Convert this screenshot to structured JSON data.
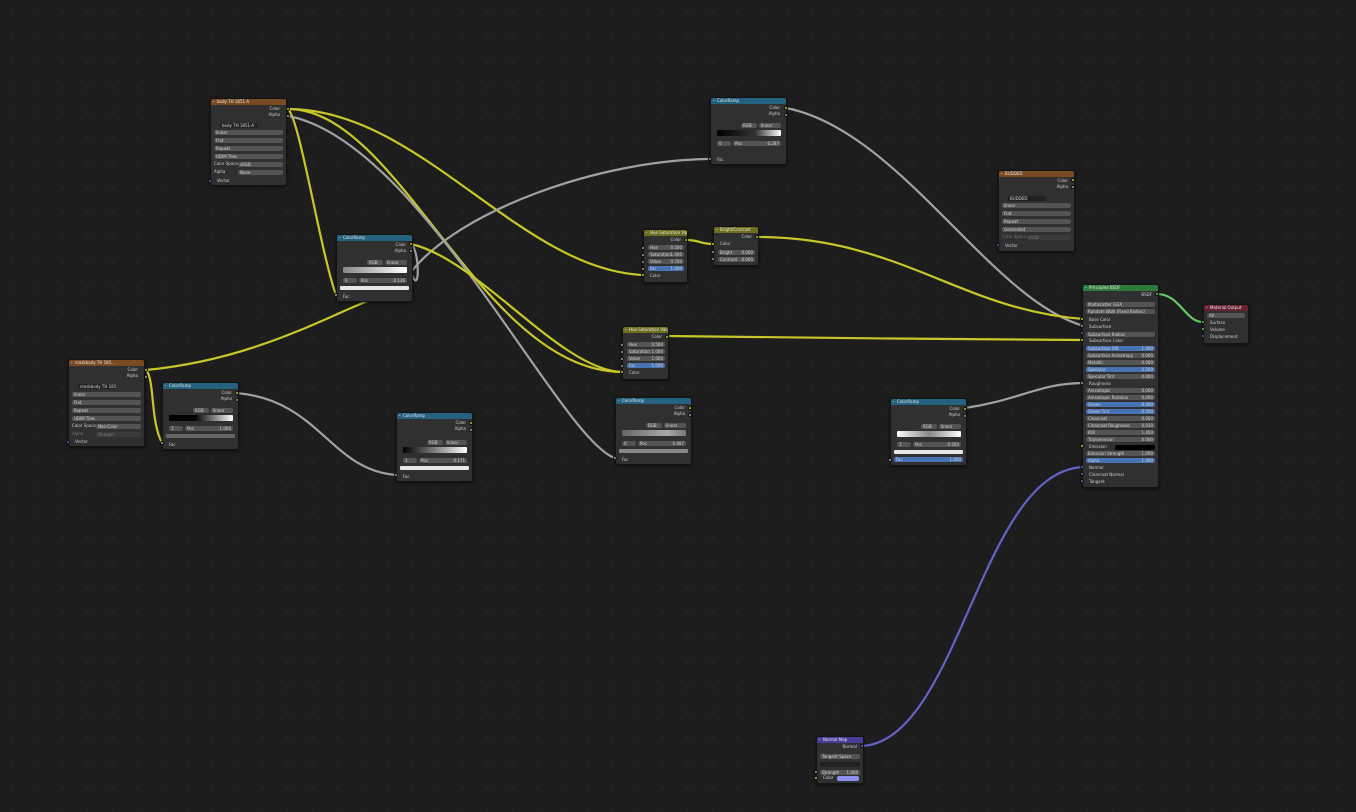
{
  "colors": {
    "background": "#1d1d1d",
    "node_body": "#303030",
    "wire_color": "#c7c729",
    "wire_float": "#a1a1a1",
    "wire_vector": "#6363c7",
    "wire_shader": "#63c763"
  },
  "common": {
    "color": "Color",
    "alpha": "Alpha",
    "fac": "Fac",
    "vector": "Vector",
    "pos": "Pos"
  },
  "tex1": {
    "title": "body TH 1851-A",
    "image": "body TH 1851-A",
    "opts": [
      "linear",
      "Flat",
      "Repeat",
      "UDIM Tiles"
    ],
    "colorspace_label": "Color Space",
    "colorspace": "sRGB",
    "alpha_label": "Alpha",
    "alpha_value": "None"
  },
  "tex2": {
    "title": "maskbody TH 185...",
    "image": "maskbody TH 185...",
    "opts": [
      "linear",
      "Flat",
      "Repeat",
      "UDIM Tiles"
    ],
    "colorspace_label": "Color Space",
    "colorspace": "Non-Color",
    "alpha_label": "Alpha",
    "alpha_value": "Straight"
  },
  "tex3": {
    "title": "BUDDED",
    "image": "BUDDED",
    "opts": [
      "linear",
      "Flat",
      "Repeat",
      "Generated"
    ],
    "colorspace_label": "Color Space",
    "colorspace": "sRGB"
  },
  "ramps": {
    "title": "ColorRamp",
    "mode": "RGB",
    "interp": "linear",
    "r1": {
      "idx": "0",
      "pos": "0.136"
    },
    "r2": {
      "idx": "1",
      "pos": "1.000"
    },
    "r3": {
      "idx": "1",
      "pos": "0.171"
    },
    "r4": {
      "idx": "0",
      "pos": "0.287"
    },
    "r5": {
      "idx": "0",
      "pos": "0.487"
    },
    "r6": {
      "idx": "1",
      "pos": "0.500"
    }
  },
  "hsv1": {
    "title": "Hue Saturation Value",
    "rows": [
      {
        "k": "Hue",
        "v": "0.500"
      },
      {
        "k": "Saturation",
        "v": "1.000"
      },
      {
        "k": "Value",
        "v": "0.700"
      },
      {
        "k": "Fac",
        "v": "1.000"
      }
    ]
  },
  "hsv2": {
    "title": "Hue Saturation Value",
    "rows": [
      {
        "k": "Hue",
        "v": "0.500"
      },
      {
        "k": "Saturation",
        "v": "1.000"
      },
      {
        "k": "Value",
        "v": "1.000"
      },
      {
        "k": "Fac",
        "v": "1.000"
      }
    ]
  },
  "bc": {
    "title": "Bright/Contrast",
    "rows": [
      {
        "k": "Bright",
        "v": "0.000"
      },
      {
        "k": "Contrast",
        "v": "0.000"
      }
    ]
  },
  "bsdf": {
    "title": "Principled BSDF",
    "out": "BSDF",
    "dist": "Multiscatter GGX",
    "sss": "Random Walk (Fixed Radius)",
    "inputs": [
      "Base Color",
      "Subsurface",
      "Subsurface Radius",
      "Subsurface Color"
    ],
    "params": [
      {
        "k": "Subsurface IOR",
        "v": "1.400",
        "hl": true
      },
      {
        "k": "Subsurface Anisotropy",
        "v": "0.000",
        "hl": false
      },
      {
        "k": "Metallic",
        "v": "0.000",
        "hl": false
      },
      {
        "k": "Specular",
        "v": "0.500",
        "hl": true
      },
      {
        "k": "Specular Tint",
        "v": "0.000",
        "hl": false
      }
    ],
    "roughness": "Roughness",
    "params2": [
      {
        "k": "Anisotropic",
        "v": "0.000",
        "hl": false
      },
      {
        "k": "Anisotropic Rotation",
        "v": "0.000",
        "hl": false
      },
      {
        "k": "Sheen",
        "v": "0.000",
        "hl": true
      },
      {
        "k": "Sheen Tint",
        "v": "0.500",
        "hl": true
      },
      {
        "k": "Clearcoat",
        "v": "0.000",
        "hl": false
      },
      {
        "k": "Clearcoat Roughness",
        "v": "0.030",
        "hl": false
      },
      {
        "k": "IOR",
        "v": "1.450",
        "hl": false
      },
      {
        "k": "Transmission",
        "v": "0.000",
        "hl": false
      }
    ],
    "emission": "Emission",
    "params3": [
      {
        "k": "Emission Strength",
        "v": "1.000",
        "hl": false
      },
      {
        "k": "Alpha",
        "v": "1.000",
        "hl": true
      }
    ],
    "tail": [
      "Normal",
      "Clearcoat Normal",
      "Tangent"
    ]
  },
  "out": {
    "title": "Material Output",
    "target": "All",
    "items": [
      "Surface",
      "Volume",
      "Displacement"
    ]
  },
  "nmap": {
    "title": "Normal Map",
    "out": "Normal",
    "space": "Tangent Space",
    "strength_k": "Strength",
    "strength_v": "1.000",
    "color": "Color"
  }
}
